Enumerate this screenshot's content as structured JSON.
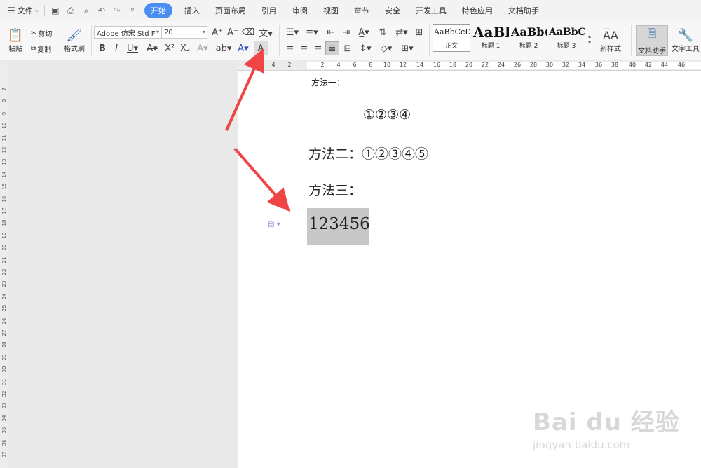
{
  "menubar": {
    "file_label": "文件",
    "tabs": [
      "开始",
      "插入",
      "页面布局",
      "引用",
      "审阅",
      "视图",
      "章节",
      "安全",
      "开发工具",
      "特色应用",
      "文档助手"
    ],
    "active_tab": "开始",
    "accent_color": "#4a8ef2"
  },
  "ribbon": {
    "paste_label": "粘贴",
    "cut_label": "剪切",
    "copy_label": "复制",
    "format_painter_label": "格式刷",
    "font_name": "Adobe 仿宋 Std F",
    "font_size": "20",
    "styles": [
      {
        "sample": "AaBbCcDd",
        "name": "正文"
      },
      {
        "sample": "AaBl",
        "name": "标题 1"
      },
      {
        "sample": "AaBb(",
        "name": "标题 2"
      },
      {
        "sample": "AaBbC",
        "name": "标题 3"
      }
    ],
    "new_style_label": "新样式",
    "doc_helper_label": "文档助手",
    "text_tools_label": "文字工具"
  },
  "hruler_ticks": [
    "4",
    "2",
    "2",
    "4",
    "6",
    "8",
    "10",
    "12",
    "14",
    "16",
    "18",
    "20",
    "22",
    "24",
    "26",
    "28",
    "30",
    "32",
    "34",
    "36",
    "38",
    "40",
    "42",
    "44",
    "46"
  ],
  "vruler_ticks": [
    "7",
    "8",
    "9",
    "10",
    "11",
    "12",
    "13",
    "14",
    "15",
    "16",
    "17",
    "18",
    "19",
    "20",
    "21",
    "22",
    "23",
    "24",
    "25",
    "26",
    "27",
    "28",
    "29",
    "30",
    "31",
    "32",
    "33",
    "34",
    "35",
    "36",
    "37"
  ],
  "document": {
    "line1": "方法一：",
    "line2": "①②③④",
    "line3": "方法二：①②③④⑤",
    "line4": "方法三：",
    "line5": "123456"
  },
  "watermark": {
    "brand": "Bai du 经验",
    "url": "jingyan.baidu.com"
  }
}
